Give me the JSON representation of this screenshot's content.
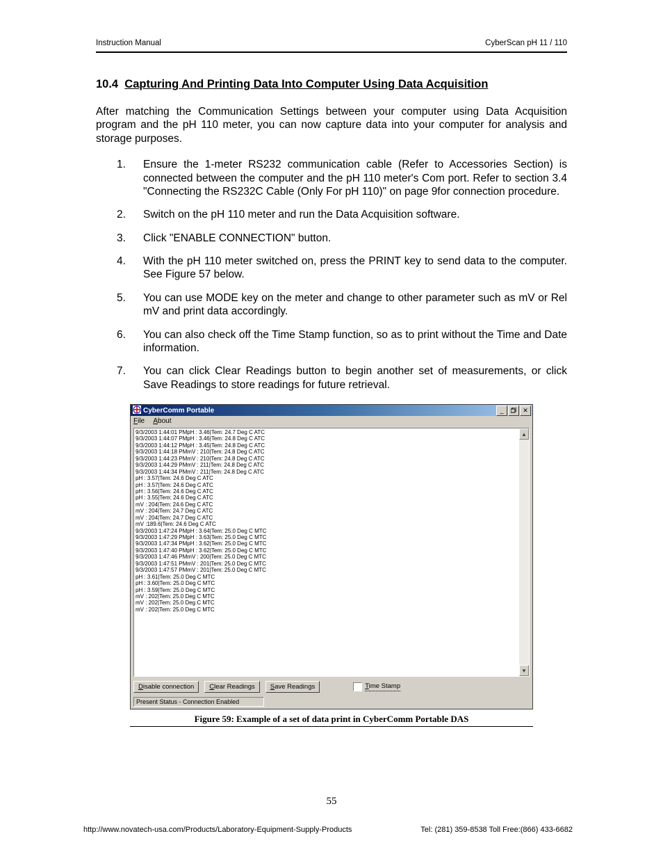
{
  "header": {
    "left": "Instruction Manual",
    "right": "CyberScan pH 11 / 110"
  },
  "section": {
    "number": "10.4",
    "title": "Capturing And Printing Data Into Computer Using Data Acquisition"
  },
  "intro": "After matching the Communication Settings between your computer using Data Acquisition program and the pH 110 meter, you can now capture data into your computer for analysis and storage purposes.",
  "steps": [
    "Ensure the 1-meter RS232 communication cable (Refer to Accessories Section) is connected between the computer and the pH 110 meter's Com port. Refer to section 3.4 \"Connecting the RS232C Cable (Only For pH 110)\" on page 9for connection procedure.",
    "Switch on the pH 110 meter and run the Data Acquisition software.",
    "Click \"ENABLE CONNECTION\" button.",
    "With the pH 110 meter switched on, press the PRINT key to send data to the computer. See Figure 57 below.",
    "You can use MODE key on the meter and change to other parameter such as mV or Rel mV and print data accordingly.",
    "You can also check off the Time Stamp function, so as to print without the Time and Date information.",
    "You can click Clear Readings button to begin another set of measurements, or click Save Readings to store readings for future retrieval."
  ],
  "app": {
    "title": "CyberComm Portable",
    "menu": {
      "file": "File",
      "about": "About"
    },
    "buttons": {
      "disable": "Disable connection",
      "clear": "Clear Readings",
      "save": "Save Readings",
      "timestamp": "Time Stamp"
    },
    "status": "Present Status - Connection Enabled",
    "data_lines": [
      "9/3/2003 1:44:01 PMpH : 3.46|Tem: 24.7 Deg C   ATC",
      "9/3/2003 1:44:07 PMpH : 3.46|Tem: 24.8 Deg C   ATC",
      "9/3/2003 1:44:12 PMpH : 3.45|Tem: 24.8 Deg C   ATC",
      "9/3/2003 1:44:18 PMmV : 210|Tem: 24.8 Deg C   ATC",
      "9/3/2003 1:44:23 PMmV : 210|Tem: 24.8 Deg C   ATC",
      "9/3/2003 1:44:29 PMmV : 211|Tem: 24.8 Deg C   ATC",
      "9/3/2003 1:44:34 PMmV : 211|Tem: 24.8 Deg C   ATC",
      "pH : 3.57|Tem: 24.6 Deg C   ATC",
      "pH : 3.57|Tem: 24.6 Deg C   ATC",
      "pH : 3.56|Tem: 24.6 Deg C   ATC",
      "pH : 3.55|Tem: 24.6 Deg C   ATC",
      "mV : 204|Tem: 24.6 Deg C   ATC",
      "mV : 204|Tem: 24.7 Deg C   ATC",
      "mV : 204|Tem: 24.7 Deg C   ATC",
      "mV :189.6|Tem: 24.6 Deg C   ATC",
      "9/3/2003 1:47:24 PMpH : 3.64|Tem: 25.0 Deg C   MTC",
      "9/3/2003 1:47:29 PMpH : 3.63|Tem: 25.0 Deg C   MTC",
      "9/3/2003 1:47:34 PMpH : 3.62|Tem: 25.0 Deg C   MTC",
      "9/3/2003 1:47:40 PMpH : 3.62|Tem: 25.0 Deg C   MTC",
      "9/3/2003 1:47:46 PMmV : 200|Tem: 25.0 Deg C   MTC",
      "9/3/2003 1:47:51 PMmV : 201|Tem: 25.0 Deg C   MTC",
      "9/3/2003 1:47:57 PMmV : 201|Tem: 25.0 Deg C   MTC",
      "pH : 3.61|Tem: 25.0 Deg C   MTC",
      "pH : 3.60|Tem: 25.0 Deg C   MTC",
      "pH : 3.59|Tem: 25.0 Deg C   MTC",
      "mV : 202|Tem: 25.0 Deg C   MTC",
      "mV : 202|Tem: 25.0 Deg C   MTC",
      "mV : 202|Tem: 25.0 Deg C   MTC"
    ]
  },
  "caption": "Figure 59: Example of a set of data print in CyberComm Portable DAS",
  "page_number": "55",
  "footer": {
    "url": "http://www.novatech-usa.com/Products/Laboratory-Equipment-Supply-Products",
    "contact": "Tel: (281) 359-8538  Toll Free:(866) 433-6682"
  }
}
